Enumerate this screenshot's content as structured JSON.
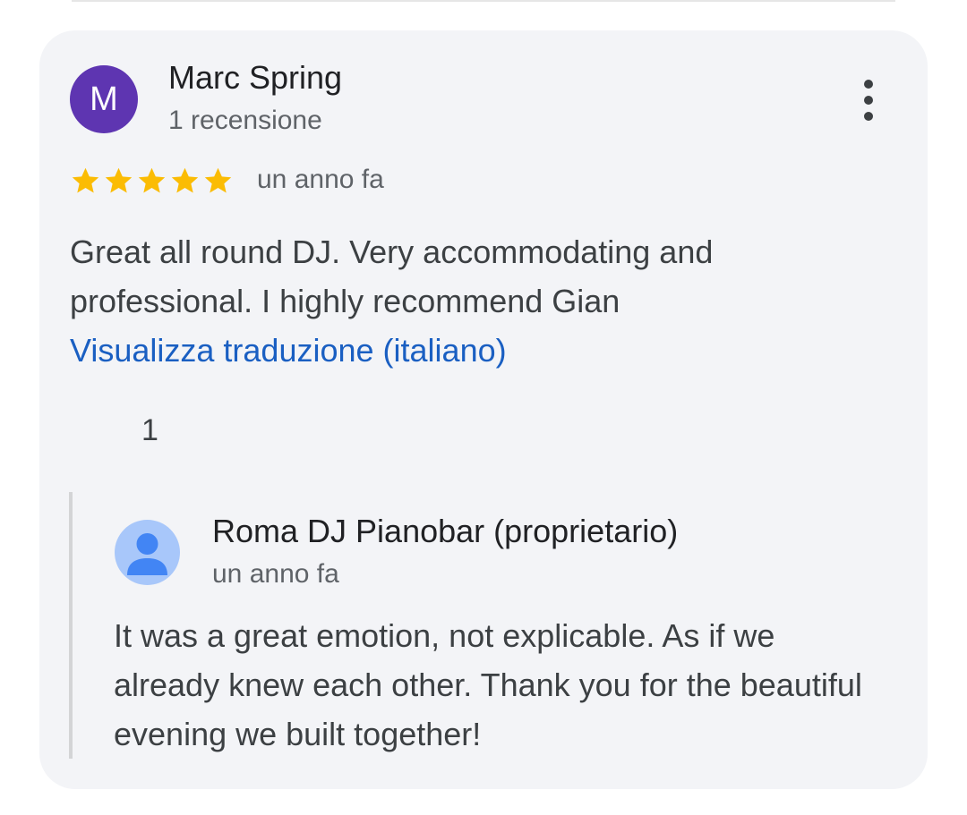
{
  "review": {
    "author_initial": "M",
    "author_name": "Marc Spring",
    "author_review_count": "1 recensione",
    "avatar_color": "#5e35b1",
    "rating": 5,
    "rating_max": 5,
    "star_color": "#fbbc04",
    "time": "un anno fa",
    "text": "Great all round DJ. Very accommodating and professional. I highly recommend Gian",
    "translate_link": "Visualizza traduzione (italiano)",
    "like_count": "1",
    "menu_icon": "more-vert-icon"
  },
  "reply": {
    "owner_name": "Roma DJ Pianobar (proprietario)",
    "time": "un anno fa",
    "text": "It was a great emotion, not explicable. As if we already knew each other. Thank you for the beautiful evening we built together!",
    "avatar_icon": "person-icon"
  }
}
